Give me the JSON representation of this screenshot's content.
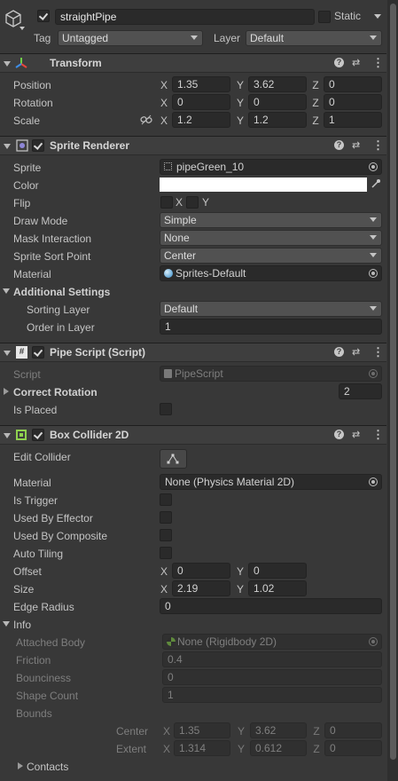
{
  "gameobject": {
    "active": true,
    "name": "straightPipe",
    "static_label": "Static",
    "static_checked": false,
    "tag_label": "Tag",
    "tag_value": "Untagged",
    "layer_label": "Layer",
    "layer_value": "Default",
    "icon": "cube-icon"
  },
  "transform": {
    "title": "Transform",
    "position": {
      "label": "Position",
      "x": "1.35",
      "y": "3.62",
      "z": "0"
    },
    "rotation": {
      "label": "Rotation",
      "x": "0",
      "y": "0",
      "z": "0"
    },
    "scale": {
      "label": "Scale",
      "x": "1.2",
      "y": "1.2",
      "z": "1"
    },
    "axis": {
      "x": "X",
      "y": "Y",
      "z": "Z"
    }
  },
  "sprite_renderer": {
    "title": "Sprite Renderer",
    "enabled": true,
    "sprite": {
      "label": "Sprite",
      "value": "pipeGreen_10"
    },
    "color": {
      "label": "Color",
      "value": "#ffffff"
    },
    "flip": {
      "label": "Flip",
      "x": "X",
      "y": "Y"
    },
    "draw_mode": {
      "label": "Draw Mode",
      "value": "Simple"
    },
    "mask_interaction": {
      "label": "Mask Interaction",
      "value": "None"
    },
    "sort_point": {
      "label": "Sprite Sort Point",
      "value": "Center"
    },
    "material": {
      "label": "Material",
      "value": "Sprites-Default"
    },
    "additional": {
      "label": "Additional Settings"
    },
    "sorting_layer": {
      "label": "Sorting Layer",
      "value": "Default"
    },
    "order_in_layer": {
      "label": "Order in Layer",
      "value": "1"
    }
  },
  "pipe_script": {
    "title": "Pipe Script (Script)",
    "enabled": true,
    "script": {
      "label": "Script",
      "value": "PipeScript"
    },
    "correct_rotation": {
      "label": "Correct Rotation",
      "value": "2"
    },
    "is_placed": {
      "label": "Is Placed",
      "checked": false
    }
  },
  "box_collider": {
    "title": "Box Collider 2D",
    "enabled": true,
    "edit_collider": {
      "label": "Edit Collider"
    },
    "material": {
      "label": "Material",
      "value": "None (Physics Material 2D)"
    },
    "is_trigger": {
      "label": "Is Trigger"
    },
    "used_by_effector": {
      "label": "Used By Effector"
    },
    "used_by_composite": {
      "label": "Used By Composite"
    },
    "auto_tiling": {
      "label": "Auto Tiling"
    },
    "offset": {
      "label": "Offset",
      "x": "0",
      "y": "0"
    },
    "size": {
      "label": "Size",
      "x": "2.19",
      "y": "1.02"
    },
    "edge_radius": {
      "label": "Edge Radius",
      "value": "0"
    },
    "info": {
      "label": "Info",
      "attached_body": {
        "label": "Attached Body",
        "value": "None (Rigidbody 2D)"
      },
      "friction": {
        "label": "Friction",
        "value": "0.4"
      },
      "bounciness": {
        "label": "Bounciness",
        "value": "0"
      },
      "shape_count": {
        "label": "Shape Count",
        "value": "1"
      },
      "bounds": {
        "label": "Bounds"
      },
      "center": {
        "label": "Center",
        "x": "1.35",
        "y": "3.62",
        "z": "0"
      },
      "extent": {
        "label": "Extent",
        "x": "1.314",
        "y": "0.612",
        "z": "0"
      },
      "contacts": {
        "label": "Contacts"
      }
    }
  },
  "colors": {
    "panel_bg": "#383838",
    "header_bg": "#3e3e3e",
    "field_bg": "#2a2a2a",
    "dropdown_bg": "#515151",
    "text": "#c4c4c4",
    "disabled_text": "#7e7e7e",
    "box_collider_icon": "#8fd14f",
    "transform_axis_red": "#e8453c",
    "transform_axis_green": "#6fcf48",
    "transform_axis_blue": "#3d8ee9"
  }
}
